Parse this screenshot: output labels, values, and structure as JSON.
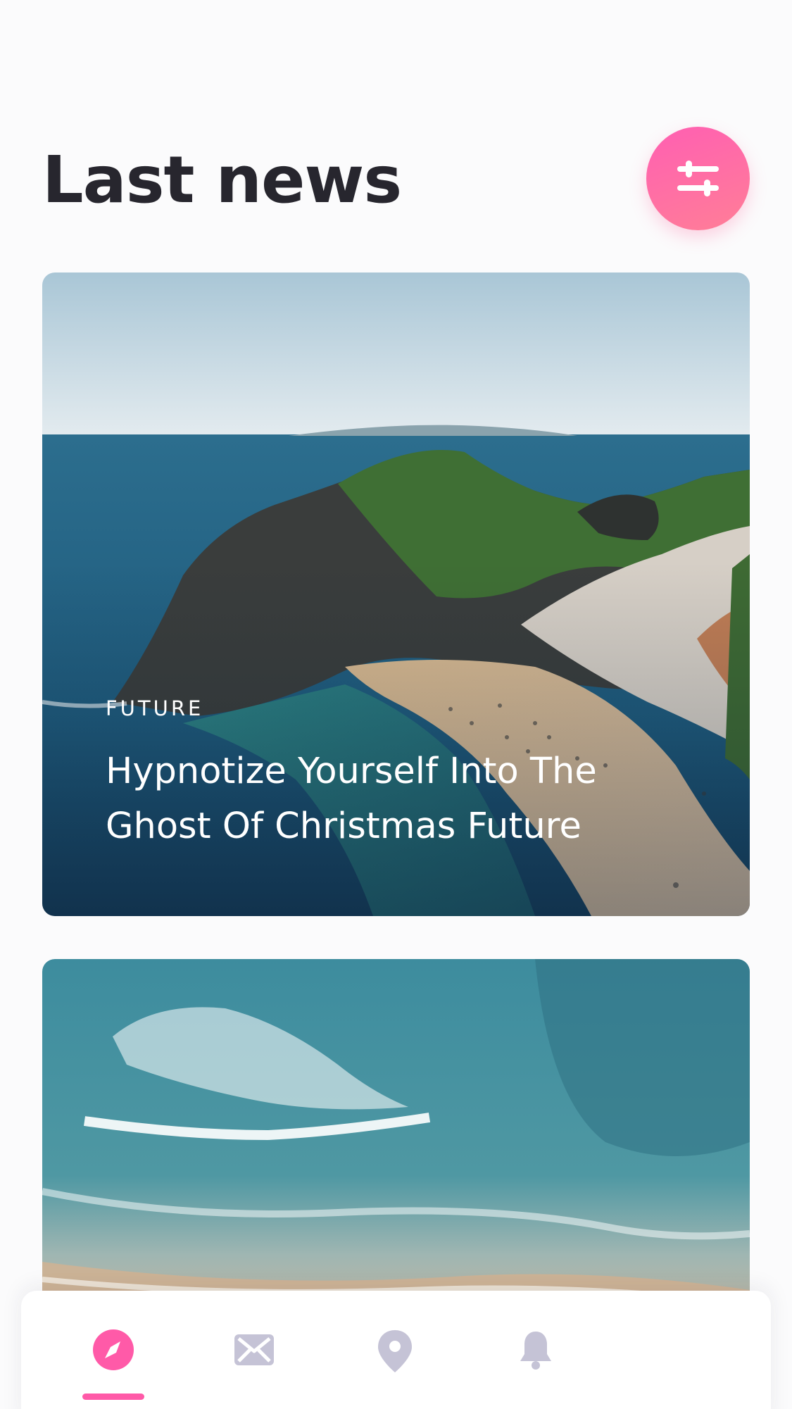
{
  "header": {
    "title": "Last news",
    "filter_icon": "sliders-icon"
  },
  "cards": [
    {
      "tag": "FUTURE",
      "title": "Hypnotize Yourself Into The Ghost Of Christmas Future",
      "image": "coastal-cliffs-beach-photo"
    },
    {
      "tag": "",
      "title": "",
      "image": "aerial-ocean-waves-photo"
    }
  ],
  "bottom_nav": {
    "items": [
      {
        "icon": "compass-icon",
        "active": true
      },
      {
        "icon": "mail-icon",
        "active": false
      },
      {
        "icon": "location-pin-icon",
        "active": false
      },
      {
        "icon": "bell-icon",
        "active": false
      }
    ]
  },
  "colors": {
    "accent": "#ff5aa8",
    "title_text": "#27262e",
    "inactive_icon": "#c5c3d6",
    "background": "#fbfbfc"
  }
}
